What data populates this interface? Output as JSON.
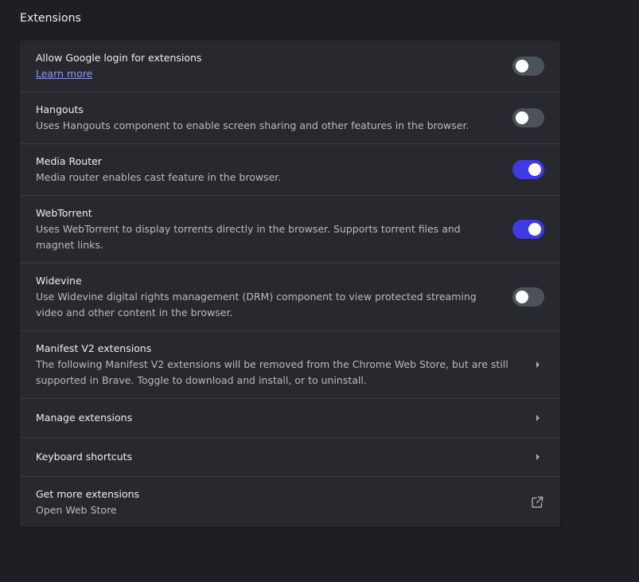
{
  "section": {
    "title": "Extensions"
  },
  "rows": {
    "google_login": {
      "label": "Allow Google login for extensions",
      "link": "Learn more",
      "enabled": false
    },
    "hangouts": {
      "label": "Hangouts",
      "desc": "Uses Hangouts component to enable screen sharing and other features in the browser.",
      "enabled": false
    },
    "media_router": {
      "label": "Media Router",
      "desc": "Media router enables cast feature in the browser.",
      "enabled": true
    },
    "webtorrent": {
      "label": "WebTorrent",
      "desc": "Uses WebTorrent to display torrents directly in the browser. Supports torrent files and magnet links.",
      "enabled": true
    },
    "widevine": {
      "label": "Widevine",
      "desc": "Use Widevine digital rights management (DRM) component to view protected streaming video and other content in the browser.",
      "enabled": false
    },
    "manifest_v2": {
      "label": "Manifest V2 extensions",
      "desc": "The following Manifest V2 extensions will be removed from the Chrome Web Store, but are still supported in Brave. Toggle to download and install, or to uninstall."
    },
    "manage": {
      "label": "Manage extensions"
    },
    "shortcuts": {
      "label": "Keyboard shortcuts"
    },
    "get_more": {
      "label": "Get more extensions",
      "desc": "Open Web Store"
    }
  },
  "colors": {
    "background": "#1e1f25",
    "card": "#28292f",
    "toggle_on": "#3f39e8",
    "toggle_off": "#4a535a",
    "link": "#8e97f5"
  },
  "icons": {
    "arrow": "chevron-right-icon",
    "external": "open-in-new-icon"
  }
}
